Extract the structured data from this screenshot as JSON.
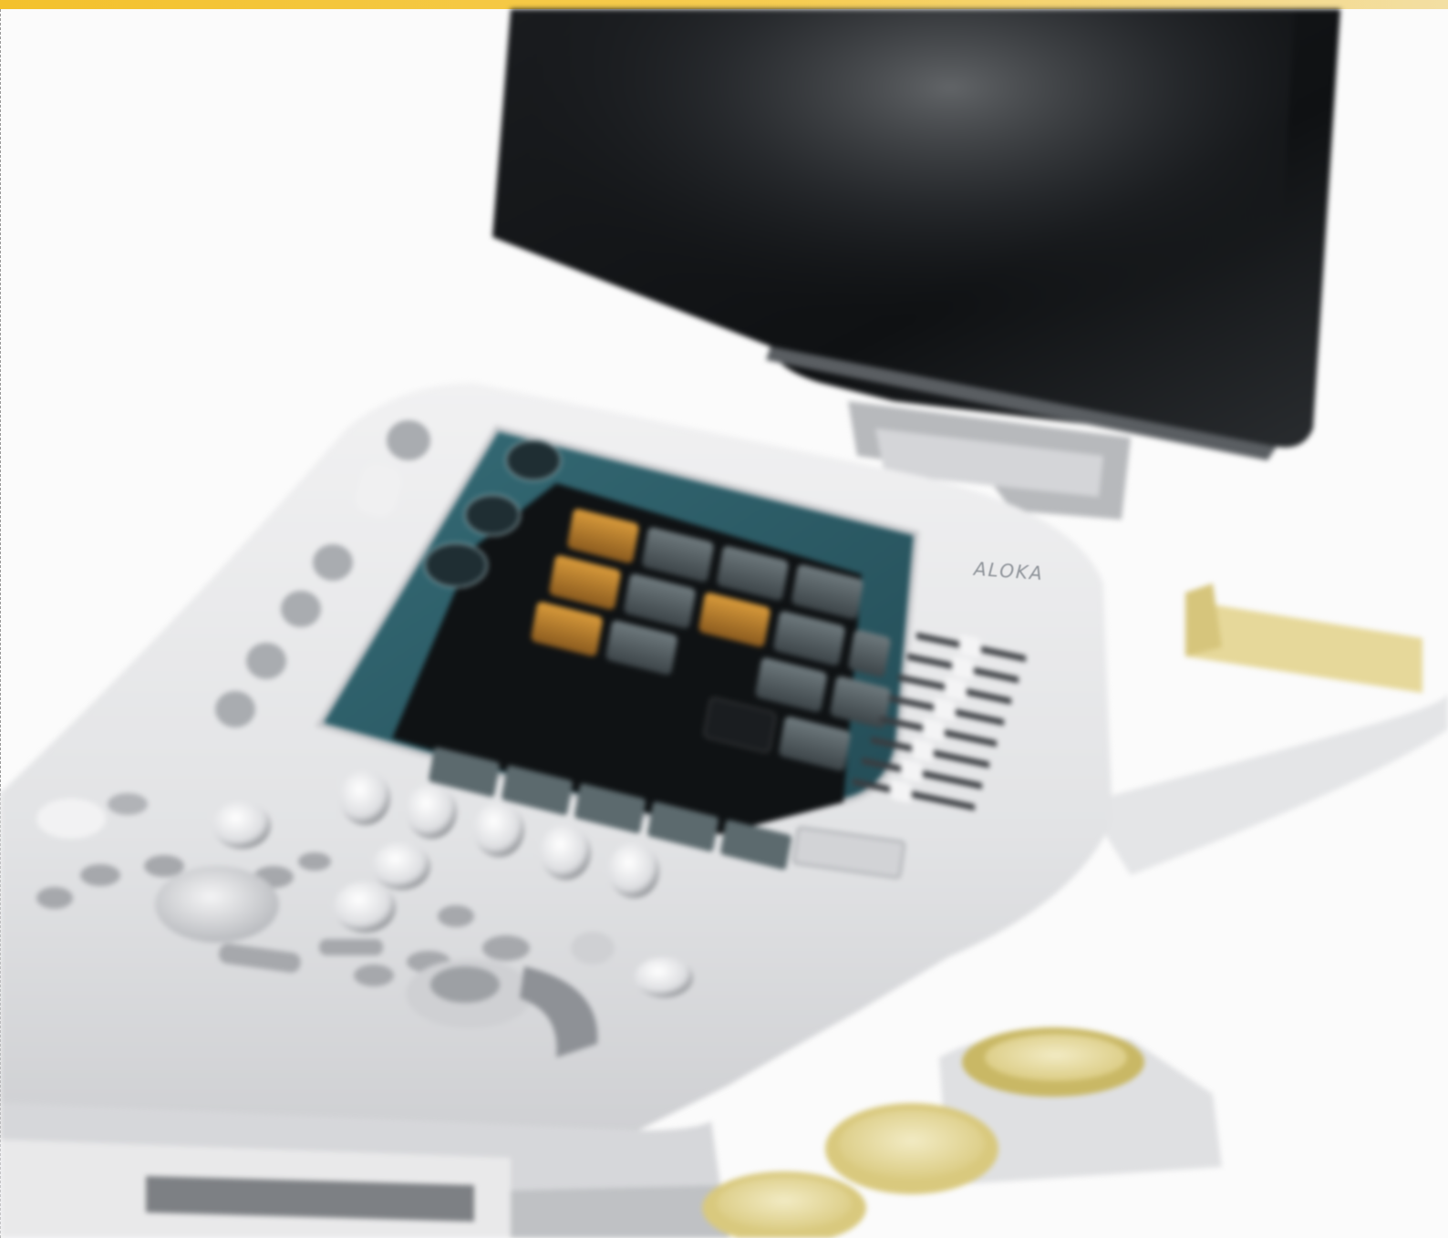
{
  "image": {
    "subject": "ultrasound-system",
    "brand": "ALOKA"
  },
  "colors": {
    "accent_band": "#f3c12c",
    "body_plastic": "#e6e7e8",
    "panel_screen": "#2e5d68",
    "screen_dark": "#111417",
    "key_orange": "#c88a2b",
    "holder_yellow": "#e8dca0"
  }
}
